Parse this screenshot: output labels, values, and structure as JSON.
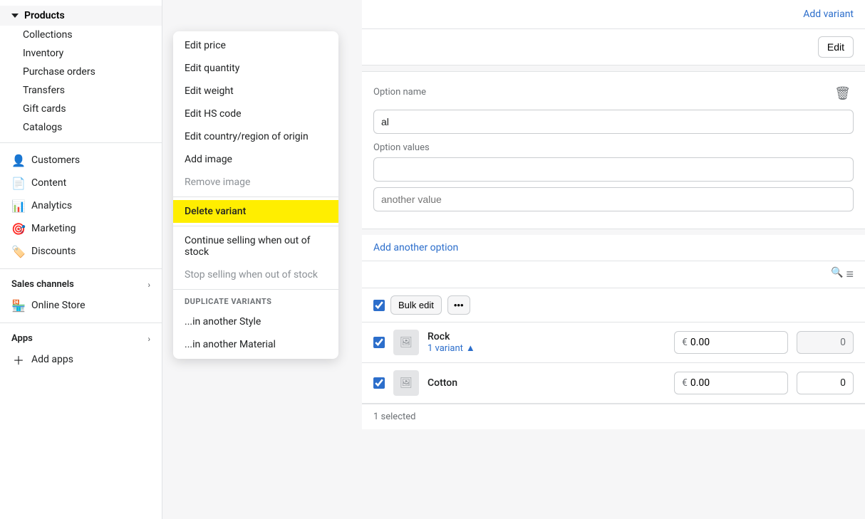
{
  "sidebar": {
    "products_header": "Products",
    "sub_items": [
      {
        "label": "Collections",
        "id": "collections"
      },
      {
        "label": "Inventory",
        "id": "inventory"
      },
      {
        "label": "Purchase orders",
        "id": "purchase-orders"
      },
      {
        "label": "Transfers",
        "id": "transfers"
      },
      {
        "label": "Gift cards",
        "id": "gift-cards"
      },
      {
        "label": "Catalogs",
        "id": "catalogs"
      }
    ],
    "main_items": [
      {
        "label": "Customers",
        "id": "customers",
        "icon": "👤"
      },
      {
        "label": "Content",
        "id": "content",
        "icon": "📄"
      },
      {
        "label": "Analytics",
        "id": "analytics",
        "icon": "📊"
      },
      {
        "label": "Marketing",
        "id": "marketing",
        "icon": "🎯"
      },
      {
        "label": "Discounts",
        "id": "discounts",
        "icon": "🏷️"
      }
    ],
    "sales_channels_label": "Sales channels",
    "online_store_label": "Online Store",
    "apps_label": "Apps",
    "add_apps_label": "Add apps"
  },
  "context_menu": {
    "items": [
      {
        "label": "Edit price",
        "id": "edit-price",
        "state": "normal"
      },
      {
        "label": "Edit quantity",
        "id": "edit-quantity",
        "state": "normal"
      },
      {
        "label": "Edit weight",
        "id": "edit-weight",
        "state": "normal"
      },
      {
        "label": "Edit HS code",
        "id": "edit-hs-code",
        "state": "normal"
      },
      {
        "label": "Edit country/region of origin",
        "id": "edit-country",
        "state": "normal"
      },
      {
        "label": "Add image",
        "id": "add-image",
        "state": "normal"
      },
      {
        "label": "Remove image",
        "id": "remove-image",
        "state": "disabled"
      },
      {
        "label": "Delete variant",
        "id": "delete-variant",
        "state": "highlighted"
      },
      {
        "label": "Continue selling when out of stock",
        "id": "continue-selling",
        "state": "normal"
      },
      {
        "label": "Stop selling when out of stock",
        "id": "stop-selling",
        "state": "disabled"
      }
    ],
    "duplicate_section_title": "DUPLICATE VARIANTS",
    "duplicate_items": [
      {
        "label": "...in another Style",
        "id": "dup-style"
      },
      {
        "label": "...in another Material",
        "id": "dup-material"
      }
    ]
  },
  "panel": {
    "add_variant_label": "Add variant",
    "edit_button_label": "Edit",
    "option_name_label": "Option name",
    "option_name_placeholder": "al",
    "option_values_label": "Option values",
    "option_value_placeholder": "",
    "another_value_placeholder": "another value",
    "add_another_option_label": "Add another option",
    "variants_section": {
      "bulk_edit_label": "Bulk edit",
      "rows": [
        {
          "id": "rock-row",
          "checked": true,
          "name": "Rock",
          "variant_count": "1 variant",
          "price": "€ 0.00",
          "qty": "0",
          "qty_disabled": true
        },
        {
          "id": "cotton-row",
          "checked": true,
          "name": "Cotton",
          "variant_count": null,
          "price": "€ 0.00",
          "qty": "0",
          "qty_disabled": false
        }
      ],
      "selected_label": "1 selected"
    }
  },
  "icons": {
    "search": "🔍",
    "filter": "≡",
    "image_placeholder": "🖼"
  }
}
